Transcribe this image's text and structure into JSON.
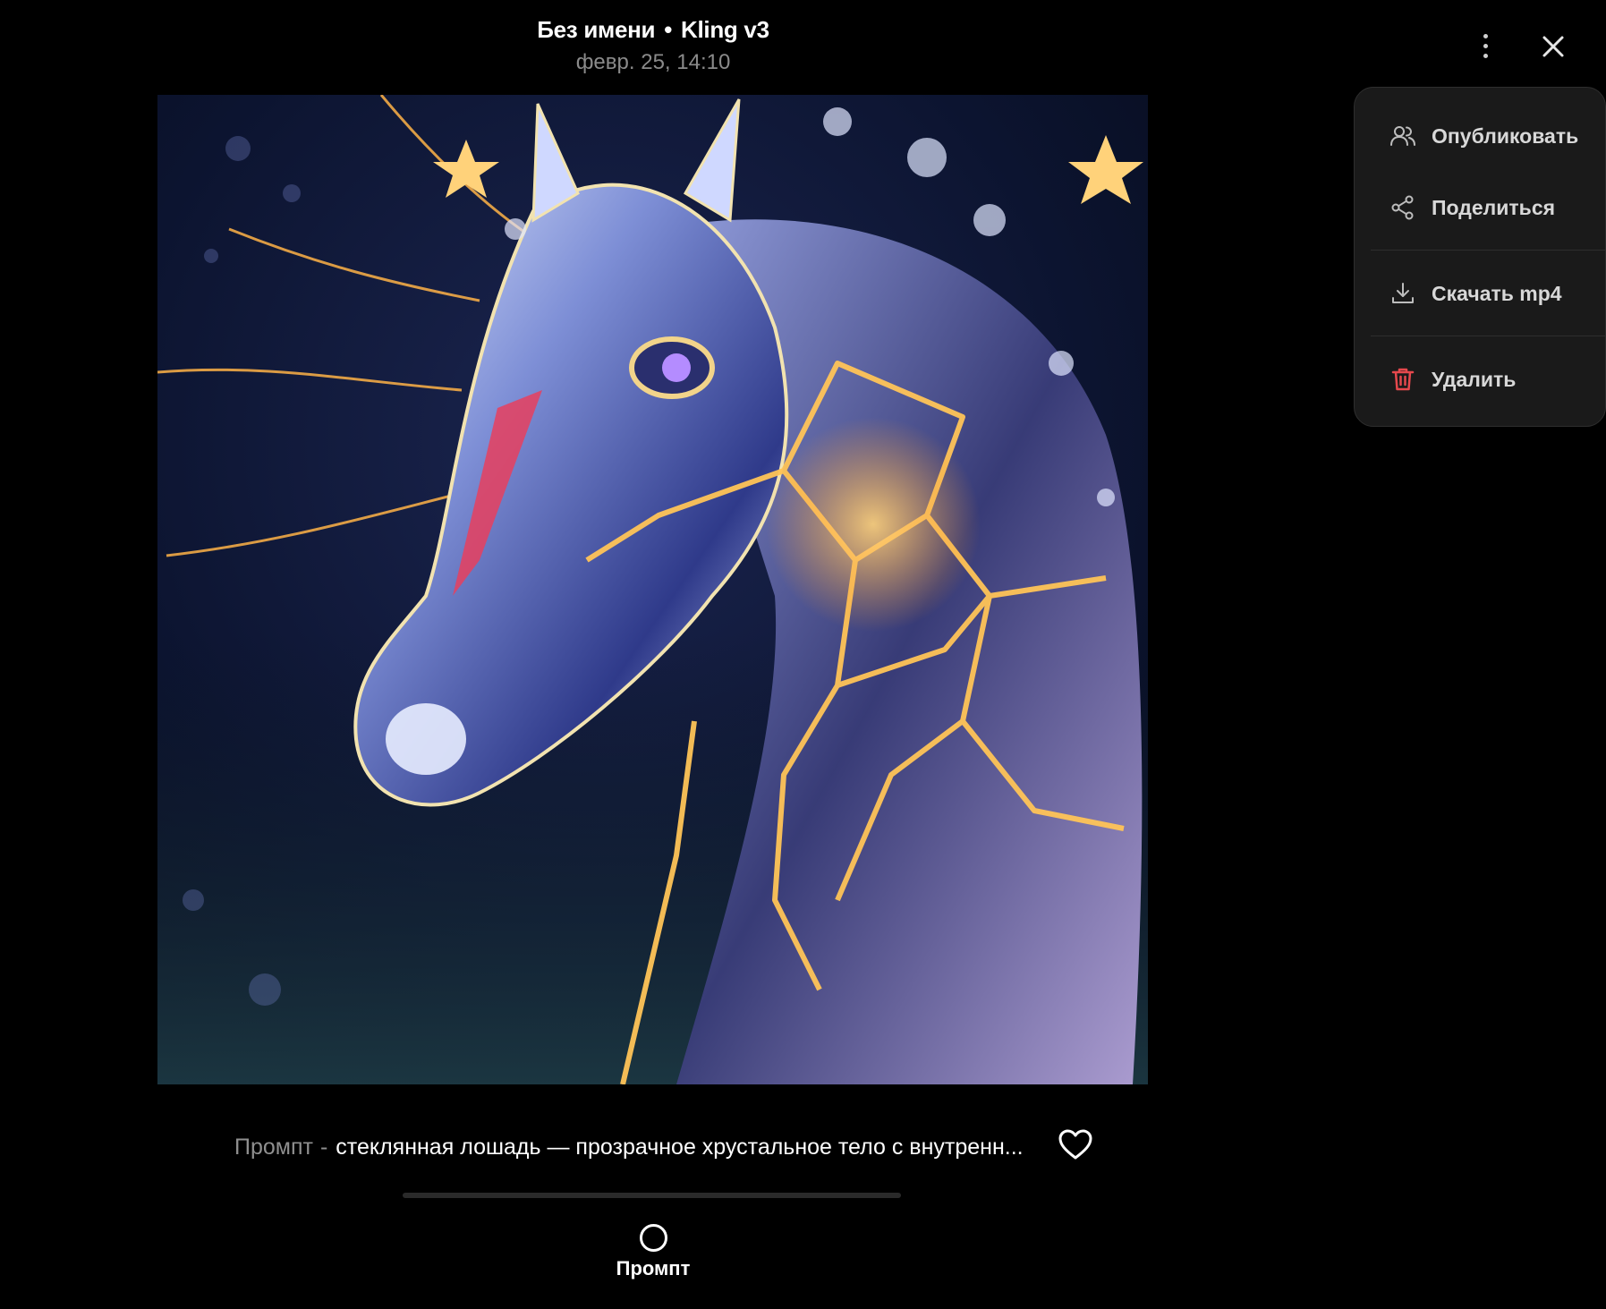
{
  "header": {
    "title": "Без имени",
    "separator": "•",
    "model": "Kling v3",
    "date": "февр. 25, 14:10"
  },
  "media": {
    "alt": "стеклянная лошадь"
  },
  "prompt": {
    "label": "Промпт",
    "separator": "-",
    "text": "стеклянная лошадь — прозрачное хрустальное тело с внутренн..."
  },
  "bottom_tab": {
    "label": "Промпт"
  },
  "menu": {
    "items": [
      {
        "label": "Опубликовать",
        "icon": "users-icon"
      },
      {
        "label": "Поделиться",
        "icon": "share-icon"
      },
      {
        "label": "Скачать mp4",
        "icon": "download-icon"
      },
      {
        "label": "Удалить",
        "icon": "trash-icon"
      }
    ]
  },
  "colors": {
    "background": "#000000",
    "menu_bg": "#1a1a1a",
    "danger": "#e5484d",
    "muted": "#8a8a8a"
  }
}
